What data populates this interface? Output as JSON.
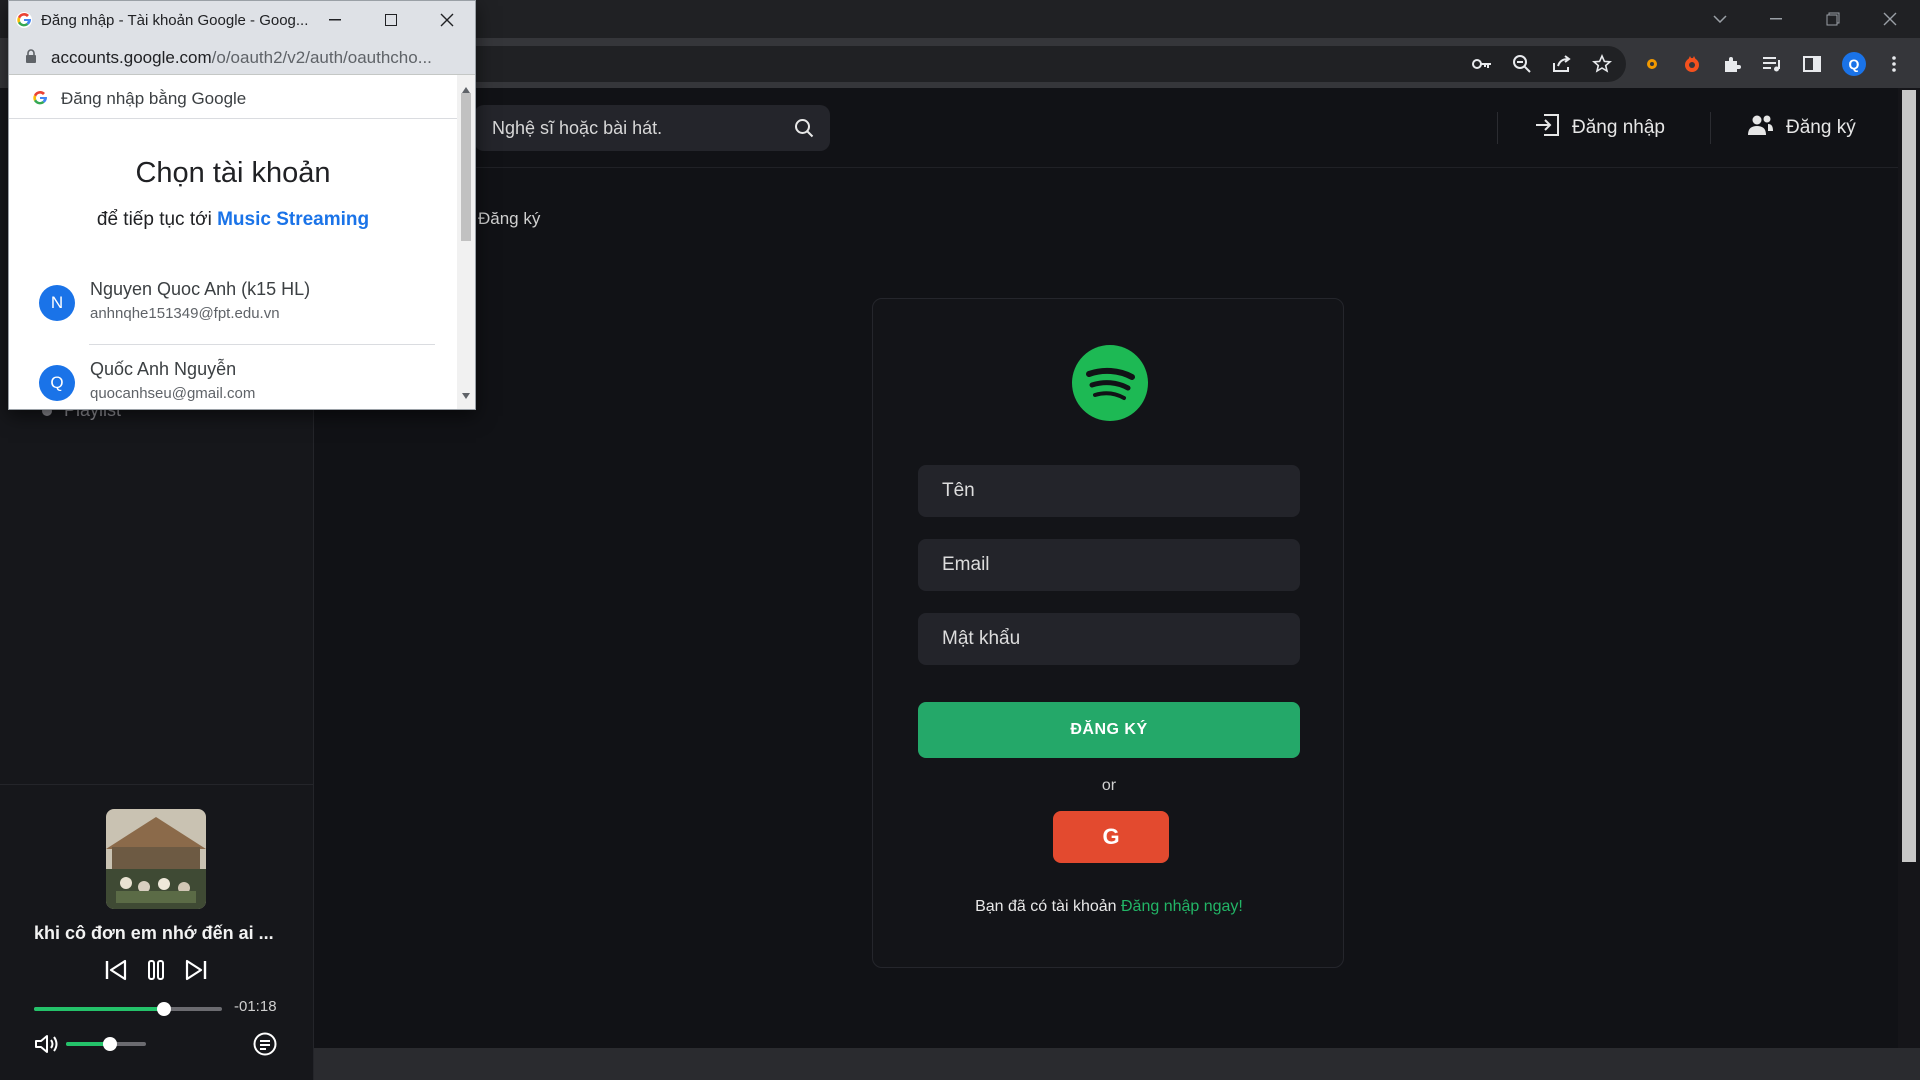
{
  "popup": {
    "window_title": "Đăng nhập - Tài khoản Google - Goog...",
    "url_host": "accounts.google.com",
    "url_path": "/o/oauth2/v2/auth/oauthcho...",
    "header": "Đăng nhập bằng Google",
    "title": "Chọn tài khoản",
    "continue_prefix": "để tiếp tục tới ",
    "app_name": "Music Streaming",
    "accounts": [
      {
        "initial": "N",
        "name": "Nguyen Quoc Anh (k15 HL)",
        "email": "anhnqhe151349@fpt.edu.vn"
      },
      {
        "initial": "Q",
        "name": "Quốc Anh Nguyễn",
        "email": "quocanhseu@gmail.com"
      }
    ]
  },
  "browser": {
    "profile_initial": "Q"
  },
  "header": {
    "search_placeholder": "Nghệ sĩ hoặc bài hát.",
    "login_label": "Đăng nhập",
    "signup_label": "Đăng ký"
  },
  "breadcrumb": "Đăng ký",
  "sidebar": {
    "playlist_label": "Playlist"
  },
  "form": {
    "name_placeholder": "Tên",
    "email_placeholder": "Email",
    "password_placeholder": "Mật khẩu",
    "submit_label": "ĐĂNG KÝ",
    "or_label": "or",
    "google_label": "G",
    "have_account_text": "Bạn đã có tài khoản ",
    "login_now_link": "Đăng nhập ngay!"
  },
  "player": {
    "track_title": "khi cô đơn em nhớ đến ai ...",
    "time_remaining": "-01:18",
    "progress_fraction": 0.69,
    "volume_fraction": 0.55
  },
  "colors": {
    "accent_green": "#24a869",
    "google_red": "#e34a2f",
    "link_blue": "#1a73e8",
    "spotify_green": "#1db954"
  }
}
